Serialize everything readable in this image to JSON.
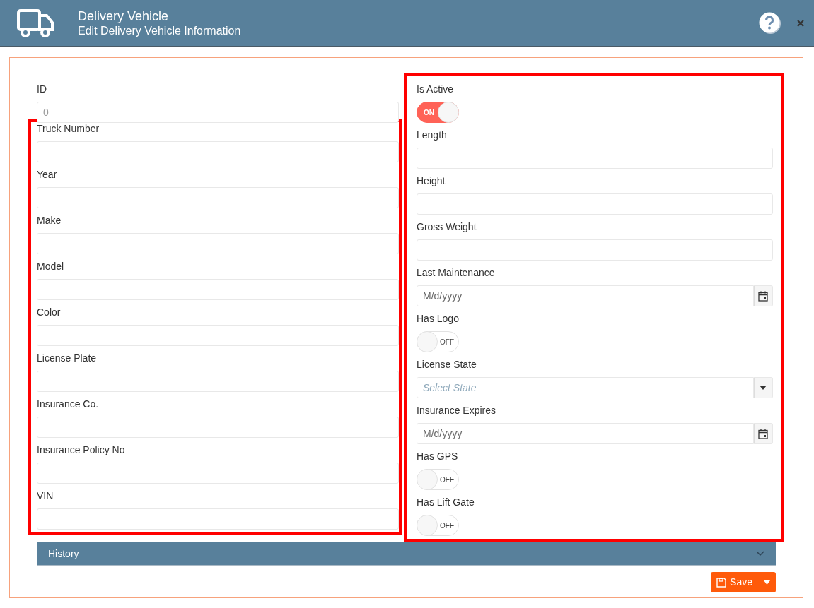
{
  "header": {
    "title": "Delivery Vehicle",
    "subtitle": "Edit Delivery Vehicle Information"
  },
  "id_field": {
    "label": "ID",
    "value": "0",
    "disabled": true
  },
  "left_group": {
    "highlighted": true,
    "fields": [
      {
        "label": "Truck Number",
        "kind": "text"
      },
      {
        "label": "Year",
        "kind": "text"
      },
      {
        "label": "Make",
        "kind": "text"
      },
      {
        "label": "Model",
        "kind": "text"
      },
      {
        "label": "Color",
        "kind": "text"
      },
      {
        "label": "License Plate",
        "kind": "text"
      },
      {
        "label": "Insurance Co.",
        "kind": "text"
      },
      {
        "label": "Insurance Policy No",
        "kind": "text"
      },
      {
        "label": "VIN",
        "kind": "text"
      }
    ]
  },
  "right_group": {
    "highlighted": true,
    "fields": [
      {
        "label": "Is Active",
        "kind": "toggle",
        "on": true,
        "toggle_text": "ON"
      },
      {
        "label": "Length",
        "kind": "text"
      },
      {
        "label": "Height",
        "kind": "text"
      },
      {
        "label": "Gross Weight",
        "kind": "text"
      },
      {
        "label": "Last Maintenance",
        "kind": "date",
        "placeholder": "M/d/yyyy"
      },
      {
        "label": "Has Logo",
        "kind": "toggle",
        "on": false,
        "toggle_text": "OFF"
      },
      {
        "label": "License State",
        "kind": "select",
        "placeholder": "Select State"
      },
      {
        "label": "Insurance Expires",
        "kind": "date",
        "placeholder": "M/d/yyyy"
      },
      {
        "label": "Has GPS",
        "kind": "toggle",
        "on": false,
        "toggle_text": "OFF"
      },
      {
        "label": "Has Lift Gate",
        "kind": "toggle",
        "on": false,
        "toggle_text": "OFF"
      }
    ]
  },
  "history": {
    "label": "History",
    "expanded": false
  },
  "save_button": {
    "label": "Save"
  }
}
